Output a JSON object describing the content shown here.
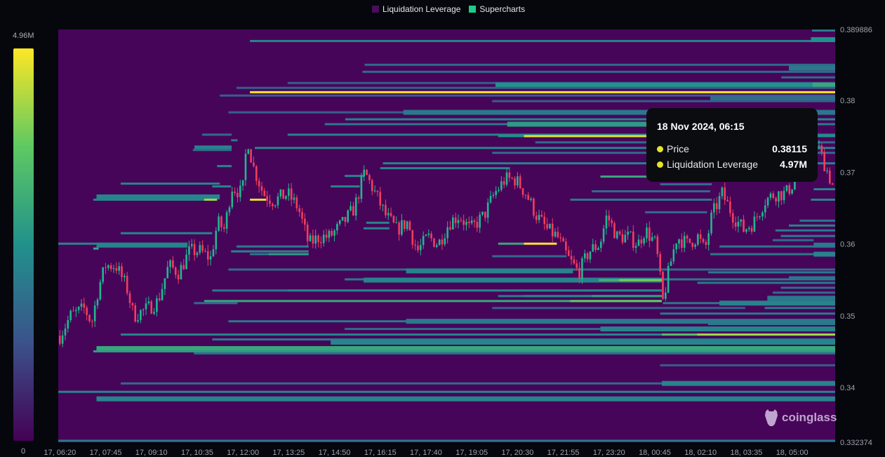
{
  "legend": [
    {
      "label": "Liquidation Leverage",
      "color": "#4a0e5c"
    },
    {
      "label": "Supercharts",
      "color": "#1fcc8a"
    }
  ],
  "colorbar": {
    "max_label": "4.96M",
    "min_label": "0"
  },
  "tooltip": {
    "title": "18 Nov 2024, 06:15",
    "rows": [
      {
        "label": "Price",
        "value": "0.38115",
        "dot_color": "#e6e52a"
      },
      {
        "label": "Liquidation Leverage",
        "value": "4.97M",
        "dot_color": "#e6e52a"
      }
    ]
  },
  "watermark": "coinglass",
  "chart_data": {
    "type": "heatmap",
    "title": "",
    "time_unit": "minutes since 17 Nov 06:20",
    "xlim": [
      -3,
      1440
    ],
    "ylim": [
      0.332374,
      0.389886
    ],
    "x_ticks": [
      {
        "t": 0,
        "label": "17, 06:20"
      },
      {
        "t": 85,
        "label": "17, 07:45"
      },
      {
        "t": 170,
        "label": "17, 09:10"
      },
      {
        "t": 255,
        "label": "17, 10:35"
      },
      {
        "t": 340,
        "label": "17, 12:00"
      },
      {
        "t": 425,
        "label": "17, 13:25"
      },
      {
        "t": 510,
        "label": "17, 14:50"
      },
      {
        "t": 595,
        "label": "17, 16:15"
      },
      {
        "t": 680,
        "label": "17, 17:40"
      },
      {
        "t": 765,
        "label": "17, 19:05"
      },
      {
        "t": 850,
        "label": "17, 20:30"
      },
      {
        "t": 935,
        "label": "17, 21:55"
      },
      {
        "t": 1020,
        "label": "17, 23:20"
      },
      {
        "t": 1105,
        "label": "18, 00:45"
      },
      {
        "t": 1190,
        "label": "18, 02:10"
      },
      {
        "t": 1275,
        "label": "18, 03:35"
      },
      {
        "t": 1360,
        "label": "18, 05:00"
      }
    ],
    "y_ticks": [
      {
        "p": 0.389886,
        "label": "0.389886"
      },
      {
        "p": 0.38,
        "label": "0.38"
      },
      {
        "p": 0.37,
        "label": "0.37"
      },
      {
        "p": 0.36,
        "label": "0.36"
      },
      {
        "p": 0.35,
        "label": "0.35"
      },
      {
        "p": 0.34,
        "label": "0.34"
      },
      {
        "p": 0.332374,
        "label": "0.332374"
      }
    ],
    "colorscale": [
      "#440154",
      "#3b528b",
      "#21918c",
      "#5ec962",
      "#fde725"
    ],
    "band_fields": [
      "price",
      "start_t",
      "end_t",
      "intensity",
      "wide_bucket"
    ],
    "bands": [
      [
        0.38974,
        1397,
        null,
        0.4,
        0
      ],
      [
        0.38828,
        353,
        null,
        0.45,
        0
      ],
      [
        0.38847,
        1395,
        null,
        0.5,
        1
      ],
      [
        0.38497,
        566,
        null,
        0.35,
        0
      ],
      [
        0.38399,
        562,
        null,
        0.35,
        0
      ],
      [
        0.3845,
        1354,
        null,
        0.4,
        1
      ],
      [
        0.38321,
        1340,
        null,
        0.35,
        0
      ],
      [
        0.38243,
        423,
        null,
        0.3,
        0
      ],
      [
        0.38214,
        809,
        null,
        0.5,
        1
      ],
      [
        0.38214,
        1398,
        null,
        0.6,
        1
      ],
      [
        0.38175,
        328,
        null,
        0.3,
        0
      ],
      [
        0.38115,
        353,
        null,
        1.0,
        0
      ],
      [
        0.38068,
        297,
        null,
        0.3,
        0
      ],
      [
        0.38029,
        1208,
        null,
        0.35,
        1
      ],
      [
        0.3799,
        803,
        null,
        0.3,
        0
      ],
      [
        0.37834,
        313,
        null,
        0.3,
        0
      ],
      [
        0.37834,
        638,
        null,
        0.4,
        1
      ],
      [
        0.37737,
        530,
        null,
        0.45,
        0
      ],
      [
        0.37669,
        492,
        null,
        0.4,
        0
      ],
      [
        0.37669,
        831,
        1090,
        0.55,
        1
      ],
      [
        0.37523,
        264,
        319,
        0.35,
        0
      ],
      [
        0.37523,
        423,
        null,
        0.45,
        0
      ],
      [
        0.37503,
        814,
        null,
        0.5,
        0
      ],
      [
        0.37503,
        862,
        1090,
        0.95,
        0
      ],
      [
        0.37445,
        318,
        330,
        0.4,
        0
      ],
      [
        0.37416,
        883,
        null,
        0.35,
        0
      ],
      [
        0.37338,
        362,
        null,
        0.45,
        0
      ],
      [
        0.37338,
        250,
        319,
        0.45,
        1
      ],
      [
        0.37309,
        247,
        319,
        0.35,
        0
      ],
      [
        0.3727,
        803,
        null,
        0.35,
        0
      ],
      [
        0.37124,
        600,
        null,
        0.45,
        0
      ],
      [
        0.37085,
        292,
        319,
        0.45,
        0
      ],
      [
        0.37056,
        595,
        836,
        0.45,
        0
      ],
      [
        0.36948,
        529,
        566,
        0.45,
        0
      ],
      [
        0.36939,
        1004,
        1090,
        0.6,
        0
      ],
      [
        0.36841,
        113,
        297,
        0.45,
        0
      ],
      [
        0.36832,
        1115,
        1211,
        0.35,
        0
      ],
      [
        0.36802,
        283,
        318,
        0.45,
        0
      ],
      [
        0.36802,
        503,
        557,
        0.45,
        0
      ],
      [
        0.36763,
        1400,
        null,
        0.45,
        0
      ],
      [
        0.36734,
        988,
        1208,
        0.35,
        0
      ],
      [
        0.36656,
        68,
        297,
        0.45,
        1
      ],
      [
        0.36617,
        62,
        273,
        0.45,
        0
      ],
      [
        0.36617,
        268,
        292,
        0.85,
        0
      ],
      [
        0.36617,
        353,
        383,
        0.95,
        0
      ],
      [
        0.36617,
        948,
        1211,
        0.4,
        0
      ],
      [
        0.36617,
        1395,
        null,
        0.45,
        0
      ],
      [
        0.36442,
        1087,
        1202,
        0.35,
        0
      ],
      [
        0.36325,
        1374,
        null,
        0.4,
        0
      ],
      [
        0.36296,
        569,
        612,
        0.45,
        0
      ],
      [
        0.36257,
        1354,
        null,
        0.45,
        0
      ],
      [
        0.36218,
        564,
        612,
        0.45,
        0
      ],
      [
        0.36189,
        1329,
        null,
        0.4,
        0
      ],
      [
        0.3615,
        113,
        283,
        0.45,
        0
      ],
      [
        0.36111,
        1339,
        null,
        0.4,
        0
      ],
      [
        0.36053,
        1324,
        1400,
        0.35,
        0
      ],
      [
        0.36004,
        -3,
        237,
        0.45,
        0
      ],
      [
        0.35984,
        68,
        237,
        0.45,
        1
      ],
      [
        0.35984,
        1400,
        null,
        0.4,
        1
      ],
      [
        0.35936,
        62,
        72,
        0.6,
        0
      ],
      [
        0.35965,
        328,
        462,
        0.4,
        0
      ],
      [
        0.35965,
        1225,
        null,
        0.4,
        0
      ],
      [
        0.36004,
        814,
        862,
        0.6,
        0
      ],
      [
        0.36004,
        862,
        923,
        1.0,
        0
      ],
      [
        0.35897,
        318,
        462,
        0.45,
        0
      ],
      [
        0.35858,
        353,
        462,
        0.4,
        0
      ],
      [
        0.35858,
        388,
        462,
        0.55,
        0
      ],
      [
        0.35858,
        1208,
        null,
        0.4,
        0
      ],
      [
        0.35858,
        1400,
        null,
        0.45,
        1
      ],
      [
        0.35829,
        803,
        941,
        0.35,
        0
      ],
      [
        0.35644,
        313,
        null,
        0.35,
        0
      ],
      [
        0.35625,
        643,
        953,
        0.45,
        1
      ],
      [
        0.35605,
        1204,
        null,
        0.4,
        0
      ],
      [
        0.35536,
        1354,
        null,
        0.4,
        0
      ],
      [
        0.35507,
        529,
        null,
        0.4,
        0
      ],
      [
        0.35497,
        564,
        1118,
        0.45,
        1
      ],
      [
        0.35497,
        1001,
        1118,
        0.65,
        0
      ],
      [
        0.35497,
        1039,
        1118,
        0.8,
        0
      ],
      [
        0.35459,
        1184,
        null,
        0.4,
        0
      ],
      [
        0.3539,
        1339,
        null,
        0.35,
        0
      ],
      [
        0.35352,
        283,
        1118,
        0.4,
        0
      ],
      [
        0.35352,
        423,
        1118,
        0.45,
        0
      ],
      [
        0.35322,
        1324,
        null,
        0.35,
        0
      ],
      [
        0.35274,
        814,
        1118,
        0.4,
        0
      ],
      [
        0.35274,
        862,
        1118,
        0.45,
        0
      ],
      [
        0.35274,
        988,
        1118,
        0.55,
        0
      ],
      [
        0.35244,
        1314,
        null,
        0.4,
        1
      ],
      [
        0.35205,
        268,
        1118,
        0.6,
        0
      ],
      [
        0.35176,
        249,
        330,
        0.35,
        0
      ],
      [
        0.35205,
        948,
        1118,
        0.75,
        0
      ],
      [
        0.35176,
        1120,
        null,
        0.4,
        0
      ],
      [
        0.35176,
        1225,
        null,
        0.45,
        1
      ],
      [
        0.35108,
        803,
        1273,
        0.3,
        0
      ],
      [
        0.35108,
        1309,
        null,
        0.4,
        0
      ],
      [
        0.3503,
        1115,
        null,
        0.4,
        0
      ],
      [
        0.34923,
        313,
        null,
        0.4,
        0
      ],
      [
        0.34923,
        643,
        null,
        0.4,
        1
      ],
      [
        0.34884,
        1204,
        null,
        0.4,
        0
      ],
      [
        0.34816,
        529,
        1004,
        0.35,
        0
      ],
      [
        0.34816,
        1004,
        null,
        0.45,
        1
      ],
      [
        0.34738,
        113,
        null,
        0.45,
        0
      ],
      [
        0.34738,
        1118,
        null,
        0.7,
        0
      ],
      [
        0.34738,
        1184,
        null,
        0.85,
        0
      ],
      [
        0.3467,
        283,
        null,
        0.4,
        0
      ],
      [
        0.34631,
        503,
        null,
        0.45,
        1
      ],
      [
        0.34543,
        68,
        null,
        0.6,
        1
      ],
      [
        0.34504,
        62,
        null,
        0.55,
        0
      ],
      [
        0.34475,
        249,
        null,
        0.35,
        0
      ],
      [
        0.3431,
        1115,
        null,
        0.3,
        0
      ],
      [
        0.34057,
        113,
        null,
        0.35,
        0
      ],
      [
        0.34057,
        1118,
        null,
        0.45,
        1
      ],
      [
        0.3394,
        -3,
        null,
        0.45,
        0
      ],
      [
        0.33842,
        68,
        null,
        0.45,
        1
      ],
      [
        0.33258,
        -3,
        null,
        0.4,
        0
      ]
    ],
    "price_path_fields": [
      "t",
      "close"
    ],
    "price_path": [
      [
        0,
        0.3472
      ],
      [
        20,
        0.35
      ],
      [
        46,
        0.351
      ],
      [
        59,
        0.349
      ],
      [
        72,
        0.354
      ],
      [
        85,
        0.357
      ],
      [
        104,
        0.357
      ],
      [
        124,
        0.354
      ],
      [
        137,
        0.35
      ],
      [
        163,
        0.351
      ],
      [
        182,
        0.352
      ],
      [
        202,
        0.357
      ],
      [
        221,
        0.356
      ],
      [
        241,
        0.359
      ],
      [
        260,
        0.359
      ],
      [
        280,
        0.358
      ],
      [
        293,
        0.363
      ],
      [
        306,
        0.362
      ],
      [
        319,
        0.368
      ],
      [
        339,
        0.367
      ],
      [
        348,
        0.375
      ],
      [
        358,
        0.371
      ],
      [
        378,
        0.367
      ],
      [
        397,
        0.366
      ],
      [
        423,
        0.367
      ],
      [
        443,
        0.365
      ],
      [
        462,
        0.36
      ],
      [
        482,
        0.361
      ],
      [
        501,
        0.361
      ],
      [
        527,
        0.363
      ],
      [
        547,
        0.365
      ],
      [
        566,
        0.37
      ],
      [
        586,
        0.367
      ],
      [
        605,
        0.364
      ],
      [
        625,
        0.362
      ],
      [
        645,
        0.363
      ],
      [
        664,
        0.359
      ],
      [
        684,
        0.361
      ],
      [
        703,
        0.36
      ],
      [
        723,
        0.363
      ],
      [
        742,
        0.364
      ],
      [
        762,
        0.362
      ],
      [
        788,
        0.364
      ],
      [
        807,
        0.367
      ],
      [
        827,
        0.369
      ],
      [
        846,
        0.369
      ],
      [
        866,
        0.367
      ],
      [
        885,
        0.364
      ],
      [
        905,
        0.362
      ],
      [
        924,
        0.361
      ],
      [
        944,
        0.358
      ],
      [
        964,
        0.356
      ],
      [
        983,
        0.359
      ],
      [
        1003,
        0.36
      ],
      [
        1016,
        0.364
      ],
      [
        1035,
        0.361
      ],
      [
        1055,
        0.361
      ],
      [
        1074,
        0.36
      ],
      [
        1087,
        0.362
      ],
      [
        1107,
        0.36
      ],
      [
        1120,
        0.352
      ],
      [
        1133,
        0.357
      ],
      [
        1146,
        0.361
      ],
      [
        1165,
        0.36
      ],
      [
        1185,
        0.361
      ],
      [
        1198,
        0.359
      ],
      [
        1211,
        0.364
      ],
      [
        1230,
        0.367
      ],
      [
        1250,
        0.364
      ],
      [
        1270,
        0.362
      ],
      [
        1289,
        0.363
      ],
      [
        1309,
        0.366
      ],
      [
        1328,
        0.367
      ],
      [
        1348,
        0.367
      ],
      [
        1367,
        0.369
      ],
      [
        1387,
        0.372
      ],
      [
        1406,
        0.374
      ],
      [
        1426,
        0.37
      ],
      [
        1436,
        0.368
      ]
    ],
    "candle_interval_min": 5,
    "candle_colors": {
      "up": "#1fb890",
      "down": "#f23d5c"
    }
  }
}
